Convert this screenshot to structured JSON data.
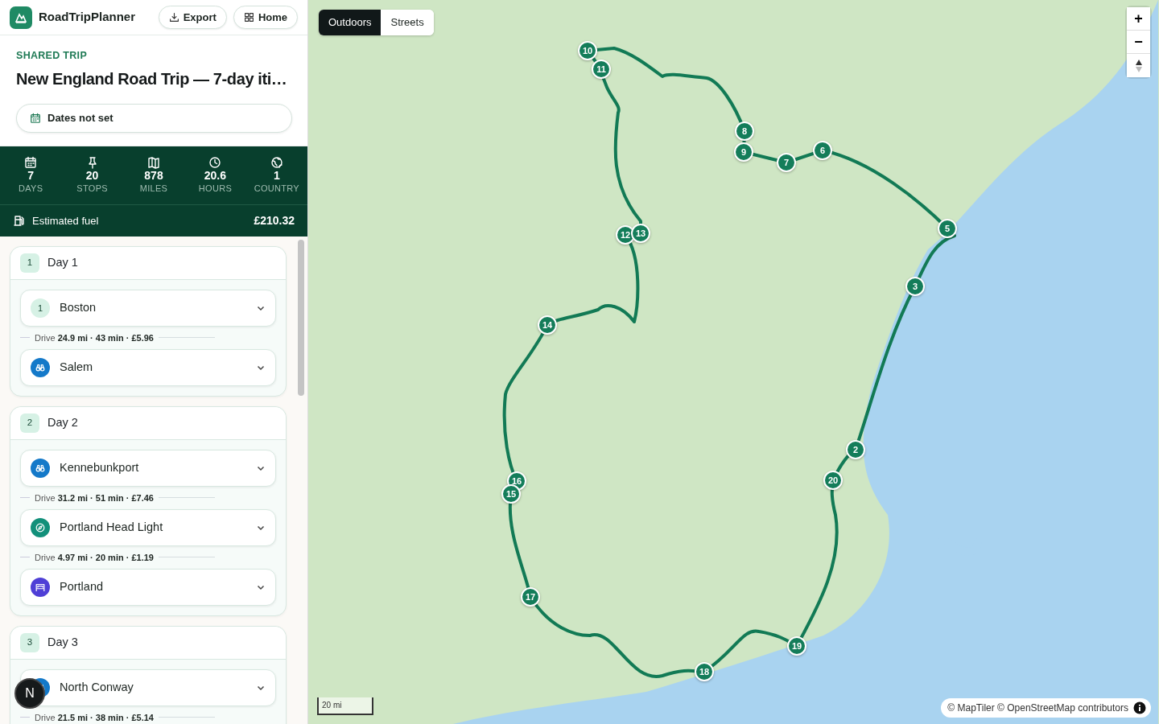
{
  "app": {
    "name": "RoadTripPlanner",
    "buttons": [
      {
        "kind": "export",
        "label": "Export"
      },
      {
        "kind": "home",
        "label": "Home"
      }
    ]
  },
  "trip": {
    "eyebrow": "SHARED TRIP",
    "title": "New England Road Trip — 7-day iti…",
    "dates": "Dates not set"
  },
  "stats": [
    {
      "kind": "calendar",
      "value": "7",
      "label": "DAYS"
    },
    {
      "kind": "pin",
      "value": "20",
      "label": "STOPS"
    },
    {
      "kind": "map",
      "value": "878",
      "label": "MILES"
    },
    {
      "kind": "clock",
      "value": "20.6",
      "label": "HOURS"
    },
    {
      "kind": "globe",
      "value": "1",
      "label": "COUNTRY"
    }
  ],
  "fuel": {
    "label": "Estimated fuel",
    "value": "£210.32"
  },
  "days": [
    {
      "number": "1",
      "title": "Day 1",
      "stops": [
        {
          "kind": "number",
          "badge": "1",
          "name": "Boston",
          "drive": "Drive **24.9 mi · 43 min · £5.96**"
        },
        {
          "kind": "sight",
          "name": "Salem"
        }
      ]
    },
    {
      "number": "2",
      "title": "Day 2",
      "stops": [
        {
          "kind": "sight",
          "name": "Kennebunkport",
          "drive": "Drive **31.2 mi · 51 min · £7.46**"
        },
        {
          "kind": "viewpoint",
          "name": "Portland Head Light",
          "drive": "Drive **4.97 mi · 20 min · £1.19**"
        },
        {
          "kind": "lodging",
          "name": "Portland"
        }
      ]
    },
    {
      "number": "3",
      "title": "Day 3",
      "stops": [
        {
          "kind": "sight",
          "name": "North Conway",
          "drive": "Drive **21.5 mi · 38 min · £5.14**"
        }
      ]
    }
  ],
  "dev_button": "N",
  "map": {
    "styles": [
      {
        "label": "Outdoors",
        "selected": true
      },
      {
        "label": "Streets",
        "selected": false
      }
    ],
    "zoom_in": "+",
    "zoom_out": "−",
    "scale": "20 mi",
    "attribution": "© MapTiler © OpenStreetMap contributors",
    "markers": [
      "10",
      "11",
      "8",
      "9",
      "7",
      "6",
      "5",
      "3",
      "2",
      "20",
      "12",
      "13",
      "14",
      "16",
      "15",
      "17",
      "18",
      "19"
    ]
  }
}
